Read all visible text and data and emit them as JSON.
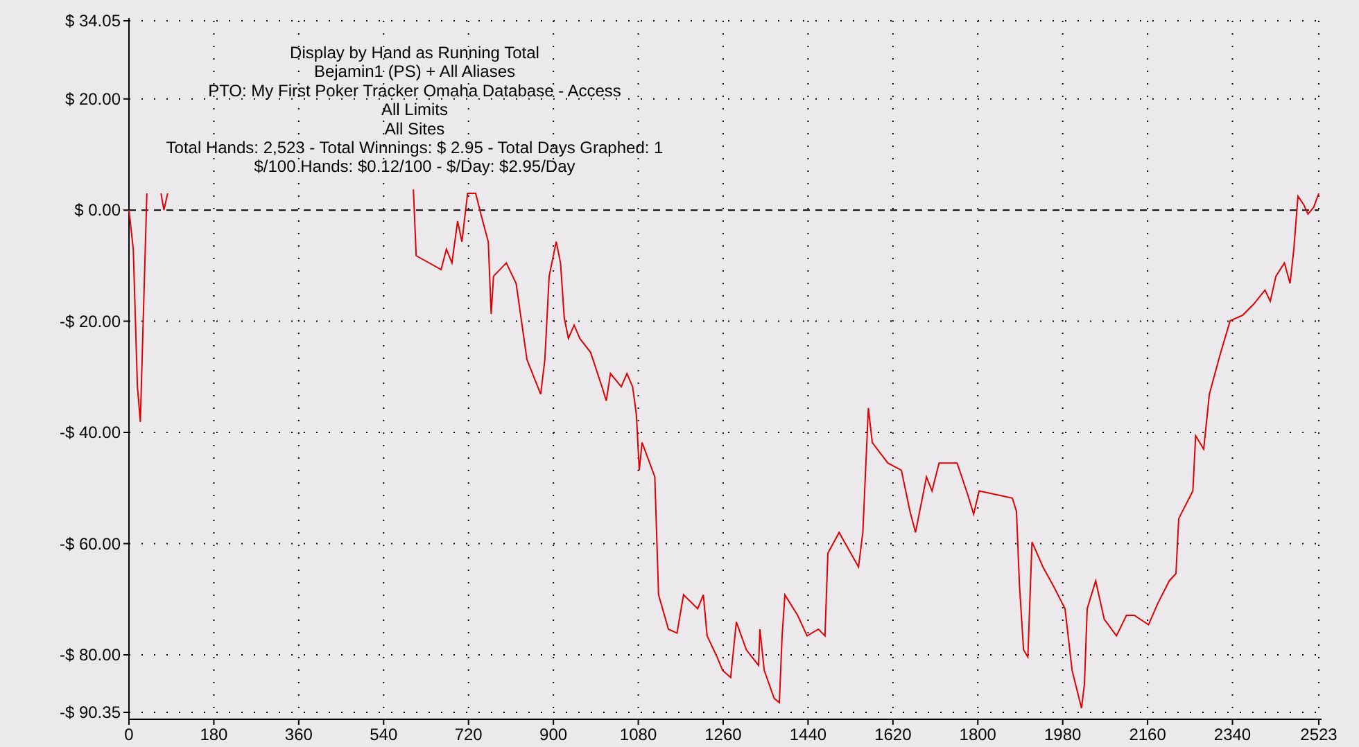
{
  "chart_header": [
    "Display by Hand as Running Total",
    "Bejamin1 (PS) + All Aliases",
    "PTO: My First Poker Tracker Omaha Database - Access",
    "All Limits",
    "All Sites",
    "Total Hands: 2,523 - Total Winnings: $ 2.95 - Total Days Graphed: 1",
    "$/100 Hands: $0.12/100 - $/Day: $2.95/Day"
  ],
  "chart_data": {
    "type": "line",
    "grid": true,
    "xlim": [
      0,
      2523
    ],
    "ylim": [
      -90.35,
      34.05
    ],
    "xticks": [
      0,
      180,
      360,
      540,
      720,
      900,
      1080,
      1260,
      1440,
      1620,
      1800,
      1980,
      2160,
      2340,
      2523
    ],
    "yticks": [
      {
        "value": 34.05,
        "label": "$ 34.05"
      },
      {
        "value": 20,
        "label": "$ 20.00"
      },
      {
        "value": 0,
        "label": "$ 0.00"
      },
      {
        "value": -20,
        "label": "-$ 20.00"
      },
      {
        "value": -40,
        "label": "-$ 40.00"
      },
      {
        "value": -60,
        "label": "-$ 60.00"
      },
      {
        "value": -80,
        "label": "-$ 80.00"
      },
      {
        "value": -90.35,
        "label": "-$ 90.35"
      }
    ],
    "series": [
      {
        "color": "#e00000",
        "x": [
          0,
          9,
          18,
          24,
          32,
          38
        ],
        "values": [
          0,
          -7.0,
          -31.8,
          -38.1,
          -14.4,
          3.0
        ]
      },
      {
        "color": "#e00000",
        "x": [
          68,
          74,
          82
        ],
        "values": [
          3.0,
          0,
          3.0
        ]
      },
      {
        "color": "#e00000",
        "x": [
          603,
          609,
          662,
          673,
          685,
          697,
          706,
          718,
          735,
          750,
          762,
          768,
          773,
          800,
          821,
          844,
          873,
          882,
          891,
          906,
          915,
          923,
          932,
          944,
          956,
          979,
          1003,
          1012,
          1021,
          1044,
          1056,
          1068,
          1076,
          1082,
          1088,
          1115,
          1123,
          1144,
          1162,
          1176,
          1206,
          1218,
          1226,
          1247,
          1259,
          1276,
          1288,
          1309,
          1335,
          1338,
          1347,
          1368,
          1379,
          1385,
          1391,
          1418,
          1438,
          1462,
          1476,
          1482,
          1506,
          1547,
          1556,
          1568,
          1576,
          1609,
          1638,
          1656,
          1668,
          1691,
          1703,
          1718,
          1756,
          1779,
          1791,
          1803,
          1873,
          1882,
          1888,
          1897,
          1906,
          1915,
          1938,
          1962,
          1985,
          2000,
          2020,
          2026,
          2032,
          2050,
          2068,
          2094,
          2115,
          2132,
          2162,
          2182,
          2206,
          2220,
          2226,
          2256,
          2262,
          2279,
          2291,
          2315,
          2335,
          2362,
          2385,
          2409,
          2420,
          2432,
          2450,
          2462,
          2470,
          2479,
          2491,
          2500,
          2512,
          2523
        ],
        "values": [
          3.7,
          -8.2,
          -10.7,
          -7.0,
          -9.5,
          -2.0,
          -5.7,
          3.0,
          3.0,
          -2.0,
          -5.7,
          -18.7,
          -11.9,
          -9.5,
          -13.2,
          -26.9,
          -33.1,
          -26.9,
          -11.9,
          -5.7,
          -9.5,
          -19.4,
          -23.1,
          -20.7,
          -23.1,
          -25.6,
          -31.8,
          -34.3,
          -29.4,
          -31.8,
          -29.4,
          -31.8,
          -36.8,
          -46.8,
          -41.8,
          -48.0,
          -69.2,
          -75.4,
          -76.1,
          -69.2,
          -71.7,
          -69.2,
          -76.6,
          -80.4,
          -82.8,
          -84.1,
          -74.1,
          -79.1,
          -81.9,
          -75.4,
          -82.8,
          -87.8,
          -88.6,
          -76.6,
          -69.2,
          -72.9,
          -76.6,
          -75.4,
          -76.6,
          -61.7,
          -58.0,
          -64.2,
          -58.0,
          -35.6,
          -41.8,
          -45.5,
          -46.8,
          -54.2,
          -58.0,
          -48.0,
          -50.5,
          -45.5,
          -45.5,
          -51.3,
          -54.7,
          -50.5,
          -51.8,
          -54.2,
          -67.2,
          -79.1,
          -80.4,
          -59.7,
          -64.2,
          -67.9,
          -71.7,
          -82.8,
          -89.6,
          -85.3,
          -71.7,
          -66.7,
          -73.6,
          -76.6,
          -72.9,
          -72.9,
          -74.6,
          -70.7,
          -66.7,
          -65.4,
          -55.5,
          -50.5,
          -40.6,
          -43.0,
          -33.1,
          -25.6,
          -19.9,
          -18.9,
          -16.9,
          -14.4,
          -16.4,
          -11.9,
          -9.5,
          -13.2,
          -7.0,
          2.5,
          1.0,
          -0.7,
          0.5,
          3.0
        ]
      }
    ]
  }
}
